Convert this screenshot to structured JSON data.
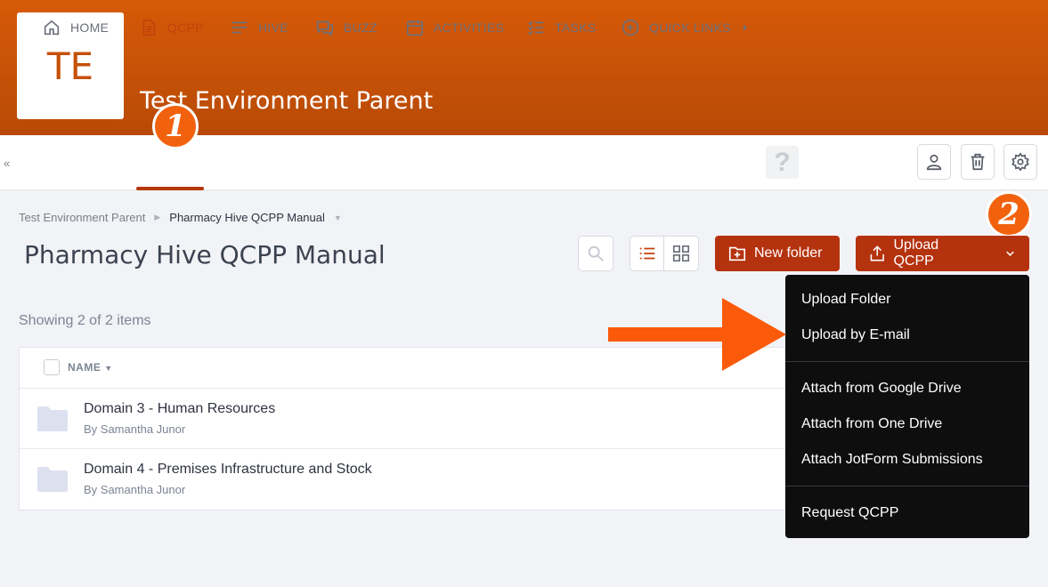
{
  "banner": {
    "initials": "TE",
    "org_name": "Test Environment Parent"
  },
  "nav": {
    "collapse": "«",
    "items": [
      {
        "label": "HOME",
        "icon": "home-icon"
      },
      {
        "label": "QCPP",
        "icon": "document-icon",
        "active": true
      },
      {
        "label": "HIVE",
        "icon": "lines-icon"
      },
      {
        "label": "BUZZ",
        "icon": "chat-icon"
      },
      {
        "label": "ACTIVITIES",
        "icon": "calendar-icon"
      },
      {
        "label": "TASKS",
        "icon": "checklist-icon"
      },
      {
        "label": "QUICK LINKS",
        "icon": "plus-circle-icon"
      }
    ],
    "help": "?"
  },
  "annotations": {
    "step1": "1",
    "step2": "2"
  },
  "breadcrumb": {
    "parent": "Test Environment Parent",
    "current": "Pharmacy Hive QCPP Manual"
  },
  "page_title": "Pharmacy Hive QCPP Manual",
  "toolbar": {
    "new_folder": "New folder",
    "upload": "Upload QCPP"
  },
  "showing": "Showing 2 of 2 items",
  "table": {
    "column_name": "NAME",
    "rows": [
      {
        "title": "Domain 3 - Human Resources",
        "author": "By Samantha Junor"
      },
      {
        "title": "Domain 4 - Premises Infrastructure and Stock",
        "author": "By Samantha Junor"
      }
    ]
  },
  "dropdown": {
    "group1": [
      "Upload Folder",
      "Upload by E-mail"
    ],
    "group2": [
      "Attach from Google Drive",
      "Attach from One Drive",
      "Attach JotForm Submissions"
    ],
    "group3": [
      "Request QCPP"
    ]
  },
  "colors": {
    "brand": "#d35607",
    "primary_button": "#b5320f",
    "annotation": "#f2620e"
  }
}
